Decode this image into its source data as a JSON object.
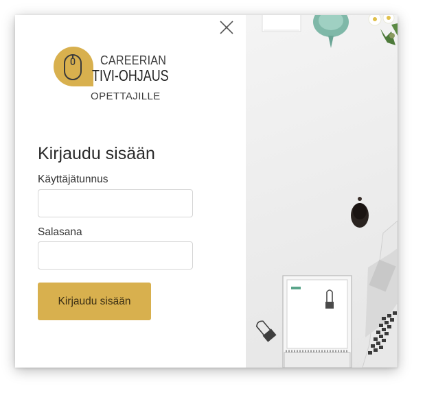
{
  "dialog": {
    "close_icon": "close-icon",
    "logo": {
      "line1": "CAREERIAN",
      "line2": "TIVI-OHJAUS",
      "line3": "OPETTAJILLE",
      "badge_color": "#d8b04e"
    },
    "title": "Kirjaudu sisään",
    "username": {
      "label": "Käyttäjätunnus",
      "value": "",
      "placeholder": ""
    },
    "password": {
      "label": "Salasana",
      "value": "",
      "placeholder": ""
    },
    "submit_label": "Kirjaudu sisään",
    "accent_color": "#d8b04e"
  }
}
